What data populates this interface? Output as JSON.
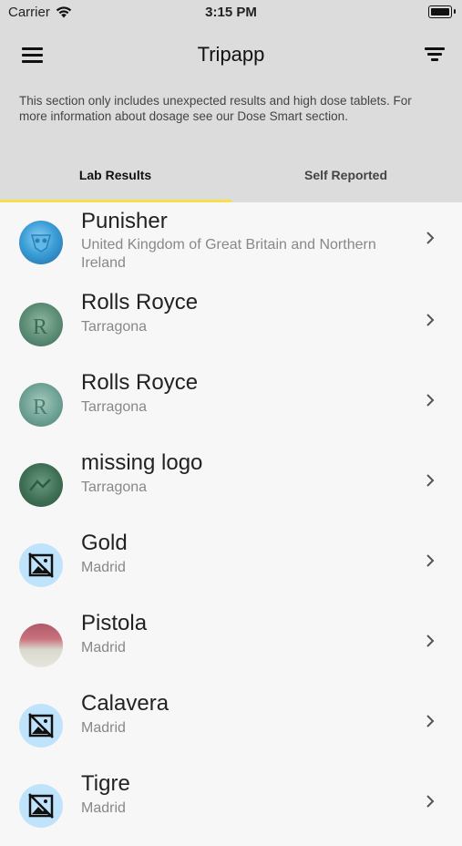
{
  "status_bar": {
    "carrier": "Carrier",
    "time": "3:15 PM"
  },
  "header": {
    "title": "Tripapp",
    "menu_icon": "hamburger-menu-icon",
    "filter_icon": "filter-icon",
    "notice": "This section only includes unexpected results and high dose tablets. For more information about dosage see our Dose Smart section."
  },
  "tabs": [
    {
      "label": "Lab Results",
      "active": true
    },
    {
      "label": "Self Reported",
      "active": false
    }
  ],
  "colors": {
    "header_bg": "#dcdcdc",
    "tab_indicator": "#f5e04a",
    "list_bg": "#f7f7f7",
    "placeholder_bg": "#bfe3fb"
  },
  "items": [
    {
      "title": "Punisher",
      "subtitle": "United Kingdom of Great Britain and Northern Ireland",
      "image": "punisher-pill-photo"
    },
    {
      "title": "Rolls Royce",
      "subtitle": "Tarragona",
      "image": "rolls-royce-pill-photo"
    },
    {
      "title": "Rolls Royce",
      "subtitle": "Tarragona",
      "image": "rolls-royce-pill-photo"
    },
    {
      "title": "missing logo",
      "subtitle": "Tarragona",
      "image": "pill-photo"
    },
    {
      "title": "Gold",
      "subtitle": "Madrid",
      "image": "image-placeholder-icon"
    },
    {
      "title": "Pistola",
      "subtitle": "Madrid",
      "image": "pill-photo"
    },
    {
      "title": "Calavera",
      "subtitle": "Madrid",
      "image": "image-placeholder-icon"
    },
    {
      "title": "Tigre",
      "subtitle": "Madrid",
      "image": "image-placeholder-icon"
    }
  ]
}
